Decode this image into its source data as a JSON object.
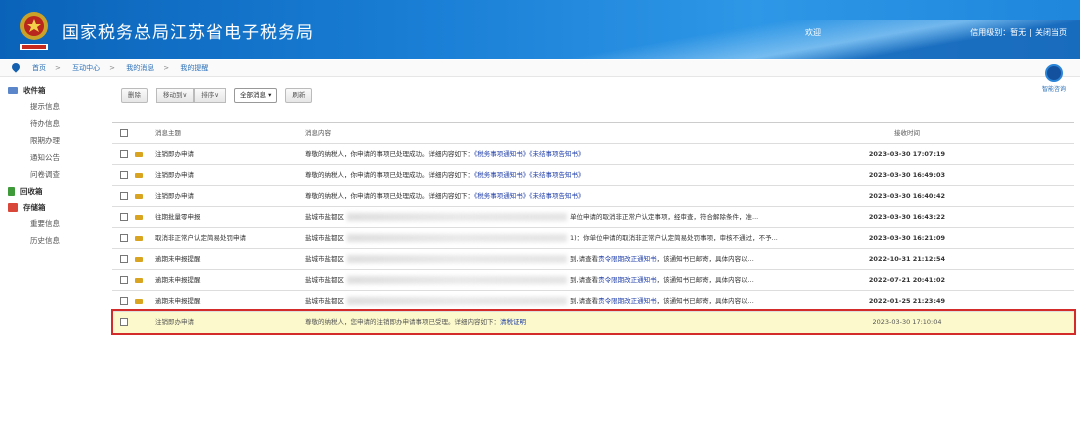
{
  "header": {
    "title": "国家税务总局江苏省电子税务局",
    "welcome": "欢迎",
    "credit_label": "信用级别：暂无",
    "close_label": "关闭当页"
  },
  "breadcrumb": [
    "首页",
    "互动中心",
    "我的消息",
    "我的提醒"
  ],
  "assistant": {
    "label": "智能咨询"
  },
  "sidebar": {
    "inbox": {
      "label": "收件箱",
      "items": [
        "提示信息",
        "待办信息",
        "限期办理",
        "通知公告",
        "问卷调查"
      ]
    },
    "recycle": {
      "label": "回收箱"
    },
    "archive": {
      "label": "存储箱",
      "items": [
        "重要信息",
        "历史信息"
      ]
    }
  },
  "toolbar": {
    "delete": "删除",
    "move_to": "移动到∨",
    "sort": "排序∨",
    "filter": "全部消息 ▾",
    "refresh": "刷新"
  },
  "table": {
    "headers": {
      "subject": "消息主题",
      "content": "消息内容",
      "time": "接收时间"
    },
    "rows": [
      {
        "subject": "注销即办申请",
        "content": "尊敬的纳税人，你申请的事项已处理成功。详细内容如下：",
        "link1": "《税务事项通知书》",
        "link2": "《未结事项告知书》",
        "time": "2023-03-30 17:07:19"
      },
      {
        "subject": "注销即办申请",
        "content": "尊敬的纳税人，你申请的事项已处理成功。详细内容如下：",
        "link1": "《税务事项通知书》",
        "link2": "《未结事项告知书》",
        "time": "2023-03-30 16:49:03"
      },
      {
        "subject": "注销即办申请",
        "content": "尊敬的纳税人，你申请的事项已处理成功。详细内容如下：",
        "link1": "《税务事项通知书》",
        "link2": "《未结事项告知书》",
        "time": "2023-03-30 16:40:42"
      },
      {
        "subject": "往期批量零申报",
        "content": "盐城市盐都区",
        "tail": "单位申请的取消非正常户认定事项，经审查，符合解除条件，准...",
        "time": "2023-03-30 16:43:22"
      },
      {
        "subject": "取消非正常户认定简易处罚申请",
        "content": "盐城市盐都区",
        "tail": "1)：你单位申请的取消非正常户认定简易处罚事项，审核不通过，不予...",
        "time": "2023-03-30 16:21:09"
      },
      {
        "subject": "逾期未申报提醒",
        "content": "盐城市盐都区",
        "tail": "到,请查看",
        "tail_link": "责令限期改正通知书",
        "tail2": "，该通知书已邮寄，具体内容以...",
        "time": "2022-10-31 21:12:54"
      },
      {
        "subject": "逾期未申报提醒",
        "content": "盐城市盐都区",
        "tail": "到,请查看",
        "tail_link": "责令限期改正通知书",
        "tail2": "，该通知书已邮寄，具体内容以...",
        "time": "2022-07-21 20:41:02"
      },
      {
        "subject": "逾期未申报提醒",
        "content": "盐城市盐都区",
        "tail": "到,请查看",
        "tail_link": "责令限期改正通知书",
        "tail2": "，该通知书已邮寄，具体内容以...",
        "time": "2022-01-25 21:23:49"
      }
    ],
    "highlighted": {
      "subject": "注销即办申请",
      "content": "尊敬的纳税人，您申请的注销即办申请事项已受理。详细内容如下：",
      "link": "清税证明",
      "time": "2023-03-30 17:10:04"
    }
  },
  "colors": {
    "header": "#1a7fd6",
    "highlight_bg": "#fcfacc",
    "highlight_border": "#d32a2a",
    "link": "#1f3ea8"
  }
}
